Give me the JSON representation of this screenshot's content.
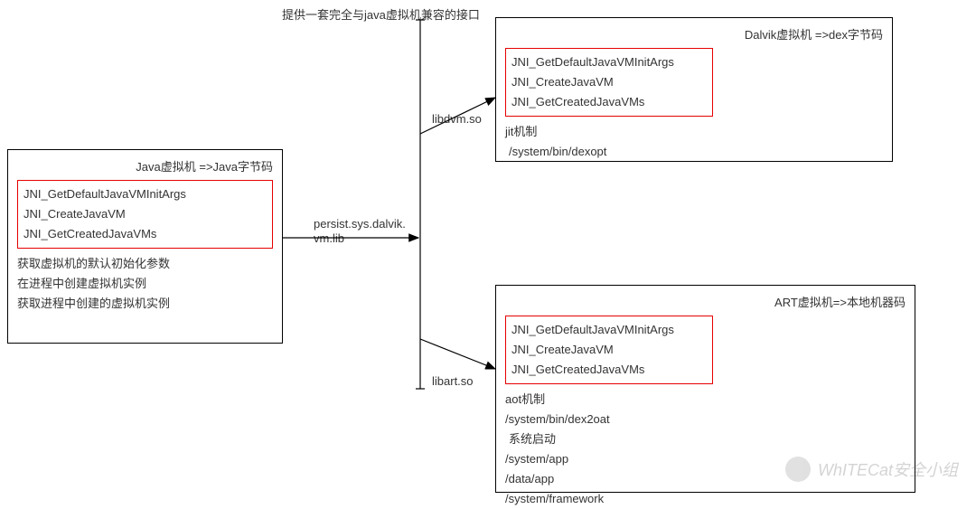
{
  "top_heading": "提供一套完全与java虚拟机兼容的接口",
  "left_box": {
    "title": "Java虚拟机 =>Java字节码",
    "jni": [
      "JNI_GetDefaultJavaVMInitArgs",
      "JNI_CreateJavaVM",
      "JNI_GetCreatedJavaVMs"
    ],
    "desc": [
      "获取虚拟机的默认初始化参数",
      "在进程中创建虚拟机实例",
      "获取进程中创建的虚拟机实例"
    ]
  },
  "mid_label": "persist.sys.dalvik.\nvm.lib",
  "top_arrow_label": "libdvm.so",
  "bottom_arrow_label": "libart.so",
  "dalvik_box": {
    "title": "Dalvik虚拟机 =>dex字节码",
    "jni": [
      "JNI_GetDefaultJavaVMInitArgs",
      "JNI_CreateJavaVM",
      "JNI_GetCreatedJavaVMs"
    ],
    "extra": [
      "jit机制",
      "/system/bin/dexopt"
    ]
  },
  "art_box": {
    "title": "ART虚拟机=>本地机器码",
    "jni": [
      "JNI_GetDefaultJavaVMInitArgs",
      "JNI_CreateJavaVM",
      "JNI_GetCreatedJavaVMs"
    ],
    "extra": [
      "aot机制",
      "/system/bin/dex2oat",
      "系统启动",
      "/system/app",
      "/data/app",
      "/system/framework"
    ]
  },
  "watermark": "WhITECat安全小组"
}
